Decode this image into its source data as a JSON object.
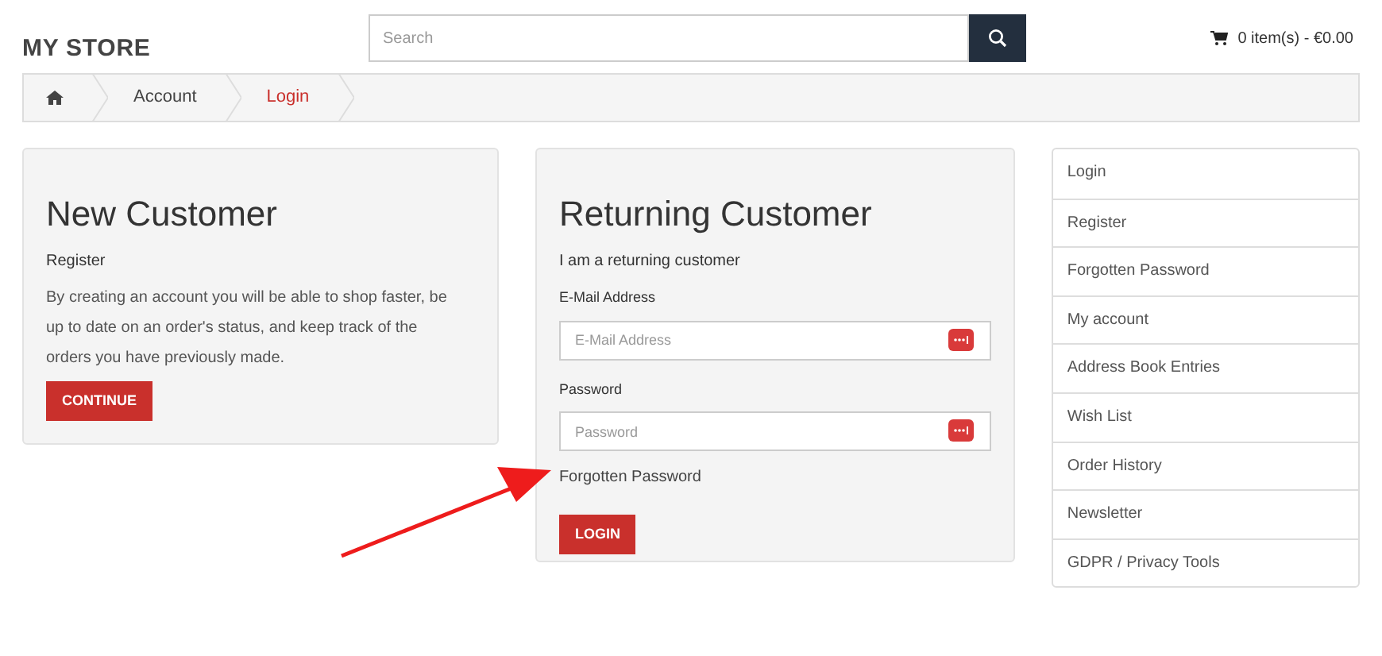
{
  "header": {
    "logo": "MY STORE",
    "search": {
      "placeholder": "Search"
    },
    "cart": "0 item(s) - €0.00"
  },
  "breadcrumb": [
    {
      "kind": "home",
      "selected": false
    },
    {
      "kind": "link",
      "label": "Account",
      "selected": false
    },
    {
      "kind": "link",
      "label": "Login",
      "selected": true
    }
  ],
  "new_customer": {
    "title": "New Customer",
    "subtitle": "Register",
    "text": "By creating an account you will be able to shop faster, be up to date on an order's status, and keep track of the orders you have previously made.",
    "button": "CONTINUE"
  },
  "returning_customer": {
    "title": "Returning Customer",
    "subtitle": "I am a returning customer",
    "fields": [
      {
        "label": "E-Mail Address",
        "placeholder": "E-Mail Address"
      },
      {
        "label": "Password",
        "placeholder": "Password"
      }
    ],
    "forgotten_link": "Forgotten Password",
    "button": "LOGIN"
  },
  "sidebar": {
    "items": [
      "Login",
      "Register",
      "Forgotten Password",
      "My account",
      "Address Book Entries",
      "Wish List",
      "Order History",
      "Newsletter",
      "GDPR / Privacy Tools"
    ]
  }
}
